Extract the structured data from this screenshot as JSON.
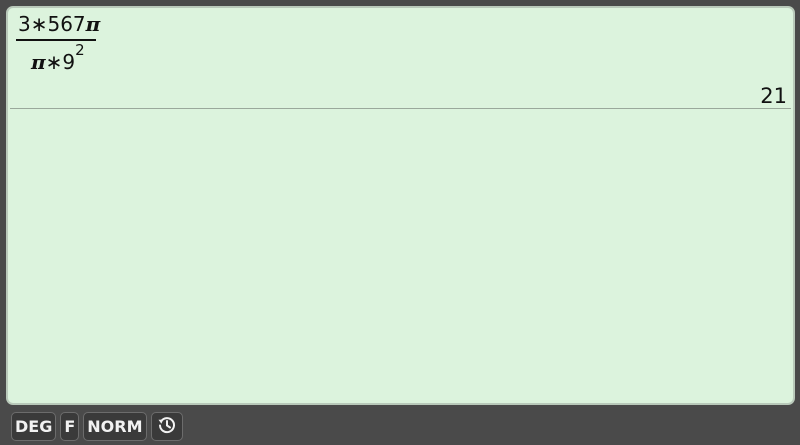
{
  "entry": {
    "numerator": "3∗567",
    "numerator_pi": "π",
    "denominator_pi": "π",
    "denominator_op": "∗9",
    "denominator_exp": "2",
    "result": "21"
  },
  "statusbar": {
    "angle_mode": "DEG",
    "format_flag": "F",
    "number_mode": "NORM",
    "history_icon": "history-icon"
  },
  "colors": {
    "screen_bg": "#dcf3dd",
    "bezel": "#4a4a4a",
    "chip_bg": "#3a3a3a"
  }
}
